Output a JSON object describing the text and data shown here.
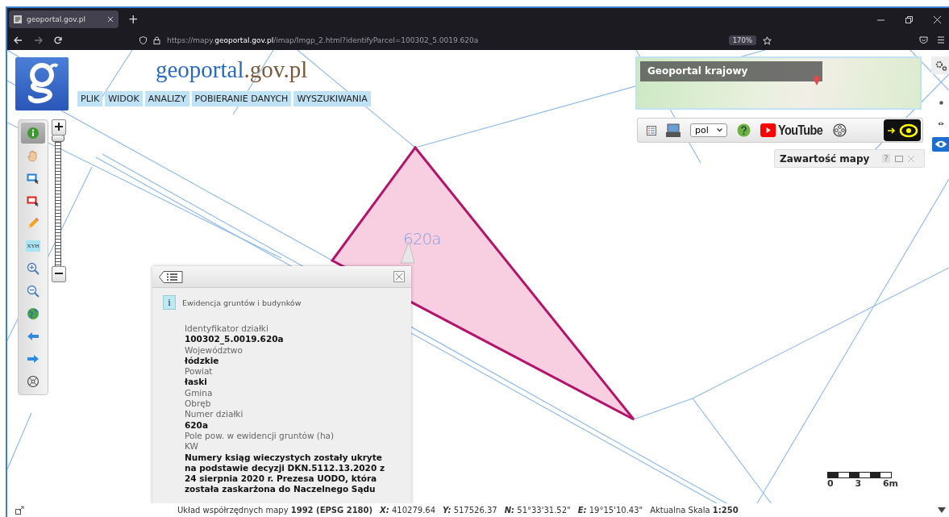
{
  "browser": {
    "tab_title": "geoportal.gov.pl",
    "new_tab": "+",
    "url": "https://mapy.**geoportal.gov.pl**/imap/Imgp_2.html?identifyParcel=100302_5.0019.620a",
    "zoom": "170%"
  },
  "header": {
    "logo_parts": [
      "geoportal",
      ".gov.pl"
    ],
    "menu": [
      "PLIK",
      "WIDOK",
      "ANALIZY",
      "POBIERANIE DANYCH",
      "WYSZUKIWANIA"
    ]
  },
  "tools": [
    {
      "kind": "info",
      "selected": true
    },
    {
      "kind": "pan",
      "selected": false
    },
    {
      "kind": "select-blue",
      "selected": false
    },
    {
      "kind": "select-red",
      "selected": false
    },
    {
      "kind": "pencil",
      "selected": false
    },
    {
      "kind": "xyh",
      "selected": false,
      "label": "XYH"
    },
    {
      "kind": "zoom-in",
      "selected": false
    },
    {
      "kind": "zoom-out",
      "selected": false
    },
    {
      "kind": "globe",
      "selected": false
    },
    {
      "kind": "back",
      "selected": false
    },
    {
      "kind": "forward",
      "selected": false
    },
    {
      "kind": "target",
      "selected": false
    }
  ],
  "zoom_slider": {
    "level": 1
  },
  "overview": {
    "title": "Geoportal krajowy"
  },
  "toolbar": {
    "language": "pol",
    "youtube": "YouTube"
  },
  "view_modes": [
    {
      "kind": "dot",
      "selected": false
    },
    {
      "kind": "eye",
      "selected": false
    },
    {
      "kind": "eye",
      "selected": true
    }
  ],
  "map_contents": {
    "title": "Zawartość mapy",
    "help": "?"
  },
  "map_label": "620a",
  "popup": {
    "layer": "Ewidencja gruntów i budynków",
    "info": "i",
    "fields": [
      {
        "label": "Identyfikator działki",
        "value": "100302_5.0019.620a"
      },
      {
        "label": "Województwo",
        "value": "łódzkie"
      },
      {
        "label": "Powiat",
        "value": "łaski"
      },
      {
        "label": "Gmina"
      },
      {
        "label": "Obręb"
      },
      {
        "label": "Numer działki",
        "value": "620a"
      },
      {
        "label": "Pole pow. w ewidencji gruntów (ha)"
      },
      {
        "label": "KW",
        "value": "Numery ksiąg wieczystych zostały ukryte na podstawie decyzji DKN.5112.13.2020 z 24 sierpnia 2020 r. Prezesa UODO, która została zaskarżona do Naczelnego Sądu"
      }
    ]
  },
  "scale": {
    "ticks": [
      "0",
      "3",
      "6m"
    ]
  },
  "status_bar": [
    "Układ współrzędnych mapy **1992 (EPSG 2180)**",
    "**X:** 410279.64",
    "**Y:** 517526.37",
    "**N:** 51°33'31.52\"",
    "**E:** 19°15'10.43\"",
    "Aktualna Skala **1:250**"
  ]
}
